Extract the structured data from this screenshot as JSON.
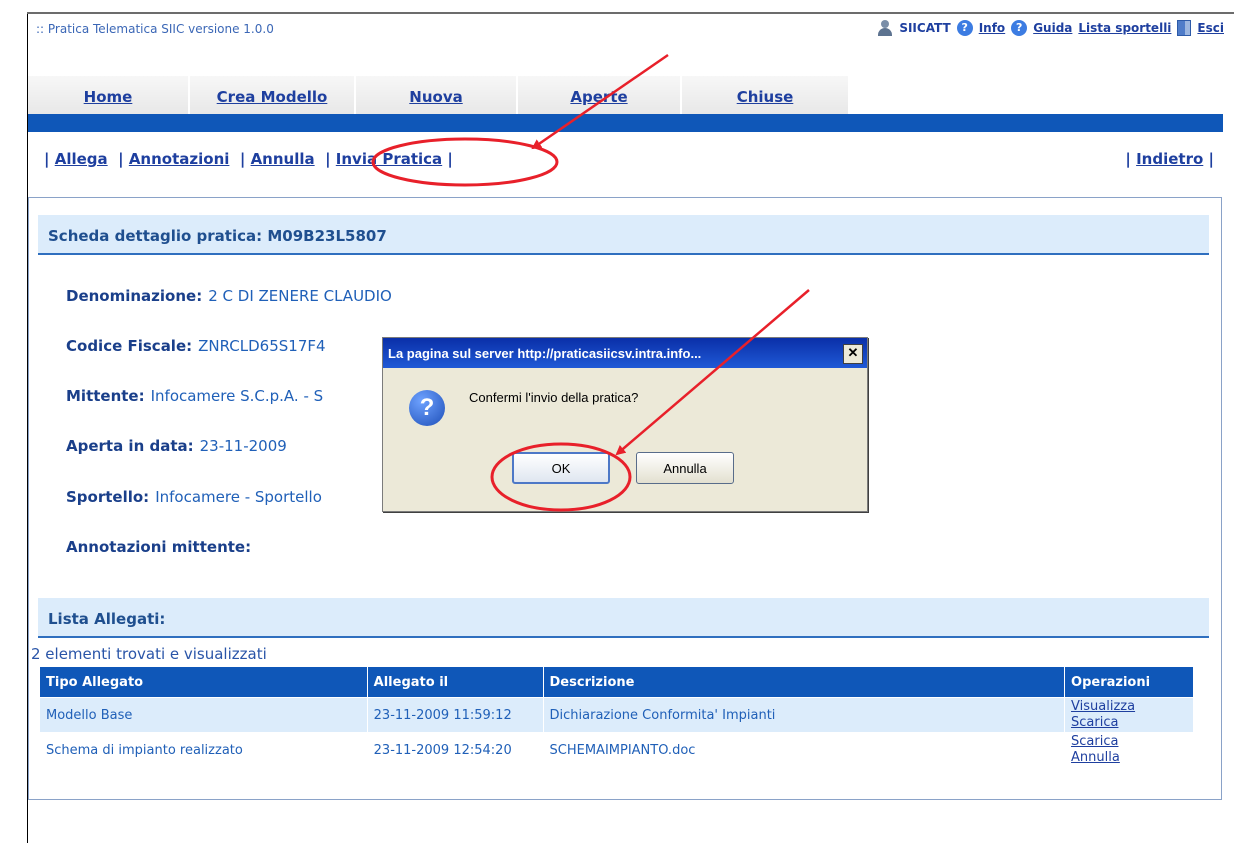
{
  "app": {
    "title": ":: Pratica Telematica SIIC versione 1.0.0"
  },
  "toplinks": {
    "user": "SIICATT",
    "info": "Info",
    "guida": "Guida",
    "lista": "Lista sportelli",
    "esci": "Esci"
  },
  "tabs": [
    {
      "label": "Home"
    },
    {
      "label": "Crea Modello"
    },
    {
      "label": "Nuova"
    },
    {
      "label": "Aperte"
    },
    {
      "label": "Chiuse"
    }
  ],
  "actions": {
    "allega": "Allega",
    "annotazioni": "Annotazioni",
    "annulla": "Annulla",
    "invia": "Invia Pratica",
    "indietro": "Indietro",
    "sep": "|"
  },
  "detail": {
    "header": "Scheda dettaglio pratica: M09B23L5807",
    "fields": [
      {
        "label": "Denominazione:",
        "value": "2 C DI ZENERE CLAUDIO"
      },
      {
        "label": "Codice Fiscale:",
        "value": "ZNRCLD65S17F4"
      },
      {
        "label": "Mittente:",
        "value": "Infocamere S.C.p.A. - S"
      },
      {
        "label": "Aperta in data:",
        "value": "23-11-2009"
      },
      {
        "label": "Sportello:",
        "value": "Infocamere - Sportello"
      },
      {
        "label": "Annotazioni mittente:",
        "value": ""
      }
    ]
  },
  "allegati": {
    "header": "Lista Allegati:",
    "count": "2 elementi trovati e visualizzati",
    "columns": [
      "Tipo Allegato",
      "Allegato il",
      "Descrizione",
      "Operazioni"
    ],
    "rows": [
      {
        "tipo": "Modello Base",
        "data": "23-11-2009 11:59:12",
        "descrizione": "Dichiarazione Conformita' Impianti",
        "op1": "Visualizza",
        "op2": "Scarica"
      },
      {
        "tipo": "Schema di impianto realizzato",
        "data": "23-11-2009 12:54:20",
        "descrizione": "SCHEMAIMPIANTO.doc",
        "op1": "Scarica",
        "op2": "Annulla"
      }
    ]
  },
  "dialog": {
    "title": "La pagina sul server http://praticasiicsv.intra.info...",
    "close": "✕",
    "icon": "?",
    "message": "Confermi l'invio della pratica?",
    "ok": "OK",
    "cancel": "Annulla"
  },
  "colors": {
    "annotation": "#e8202a",
    "nav": "#0f57b8",
    "section_bg": "#dcecfb"
  }
}
